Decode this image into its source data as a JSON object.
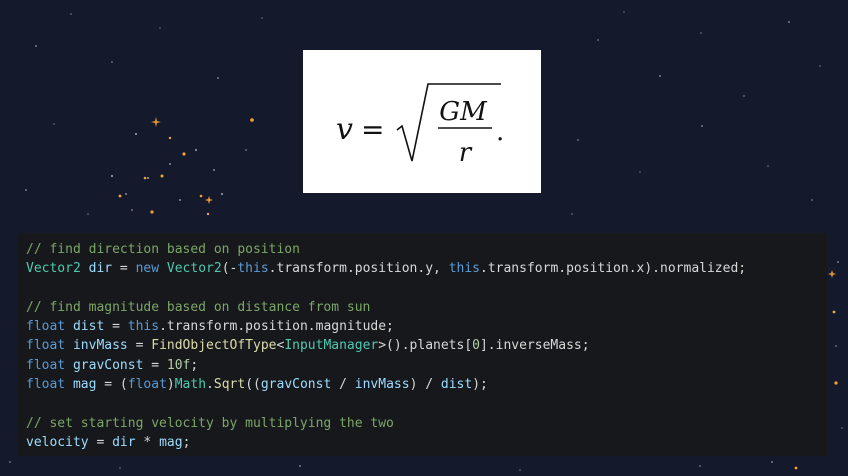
{
  "formula": {
    "lhs": "v",
    "equals": "=",
    "numerator": "GM",
    "denominator": "r",
    "trailing": "."
  },
  "code": {
    "lines": [
      [
        {
          "t": "// find direction based on position",
          "c": "comment"
        }
      ],
      [
        {
          "t": "Vector2",
          "c": "type"
        },
        {
          "t": " ",
          "c": "plain"
        },
        {
          "t": "dir",
          "c": "var"
        },
        {
          "t": " = ",
          "c": "plain"
        },
        {
          "t": "new",
          "c": "keyword"
        },
        {
          "t": " ",
          "c": "plain"
        },
        {
          "t": "Vector2",
          "c": "type"
        },
        {
          "t": "(-",
          "c": "plain"
        },
        {
          "t": "this",
          "c": "keyword"
        },
        {
          "t": ".transform.position.y, ",
          "c": "plain"
        },
        {
          "t": "this",
          "c": "keyword"
        },
        {
          "t": ".transform.position.x).normalized;",
          "c": "plain"
        }
      ],
      [],
      [
        {
          "t": "// find magnitude based on distance from sun",
          "c": "comment"
        }
      ],
      [
        {
          "t": "float",
          "c": "keyword"
        },
        {
          "t": " ",
          "c": "plain"
        },
        {
          "t": "dist",
          "c": "var"
        },
        {
          "t": " = ",
          "c": "plain"
        },
        {
          "t": "this",
          "c": "keyword"
        },
        {
          "t": ".transform.position.magnitude;",
          "c": "plain"
        }
      ],
      [
        {
          "t": "float",
          "c": "keyword"
        },
        {
          "t": " ",
          "c": "plain"
        },
        {
          "t": "invMass",
          "c": "var"
        },
        {
          "t": " = ",
          "c": "plain"
        },
        {
          "t": "FindObjectOfType",
          "c": "func"
        },
        {
          "t": "<",
          "c": "plain"
        },
        {
          "t": "InputManager",
          "c": "type"
        },
        {
          "t": ">().planets[",
          "c": "plain"
        },
        {
          "t": "0",
          "c": "num"
        },
        {
          "t": "].inverseMass;",
          "c": "plain"
        }
      ],
      [
        {
          "t": "float",
          "c": "keyword"
        },
        {
          "t": " ",
          "c": "plain"
        },
        {
          "t": "gravConst",
          "c": "var"
        },
        {
          "t": " = ",
          "c": "plain"
        },
        {
          "t": "10f",
          "c": "num"
        },
        {
          "t": ";",
          "c": "plain"
        }
      ],
      [
        {
          "t": "float",
          "c": "keyword"
        },
        {
          "t": " ",
          "c": "plain"
        },
        {
          "t": "mag",
          "c": "var"
        },
        {
          "t": " = (",
          "c": "plain"
        },
        {
          "t": "float",
          "c": "keyword"
        },
        {
          "t": ")",
          "c": "plain"
        },
        {
          "t": "Math",
          "c": "type"
        },
        {
          "t": ".",
          "c": "plain"
        },
        {
          "t": "Sqrt",
          "c": "func"
        },
        {
          "t": "((",
          "c": "plain"
        },
        {
          "t": "gravConst",
          "c": "var"
        },
        {
          "t": " / ",
          "c": "plain"
        },
        {
          "t": "invMass",
          "c": "var"
        },
        {
          "t": ") / ",
          "c": "plain"
        },
        {
          "t": "dist",
          "c": "var"
        },
        {
          "t": ");",
          "c": "plain"
        }
      ],
      [],
      [
        {
          "t": "// set starting velocity by multiplying the two",
          "c": "comment"
        }
      ],
      [
        {
          "t": "velocity",
          "c": "var"
        },
        {
          "t": " = ",
          "c": "plain"
        },
        {
          "t": "dir",
          "c": "var"
        },
        {
          "t": " * ",
          "c": "plain"
        },
        {
          "t": "mag",
          "c": "var"
        },
        {
          "t": ";",
          "c": "plain"
        }
      ]
    ]
  },
  "colors": {
    "background": "#14192b",
    "code_background": "#17181b",
    "star_white": "#c9cfe4",
    "star_orange": "#f2a33a"
  }
}
